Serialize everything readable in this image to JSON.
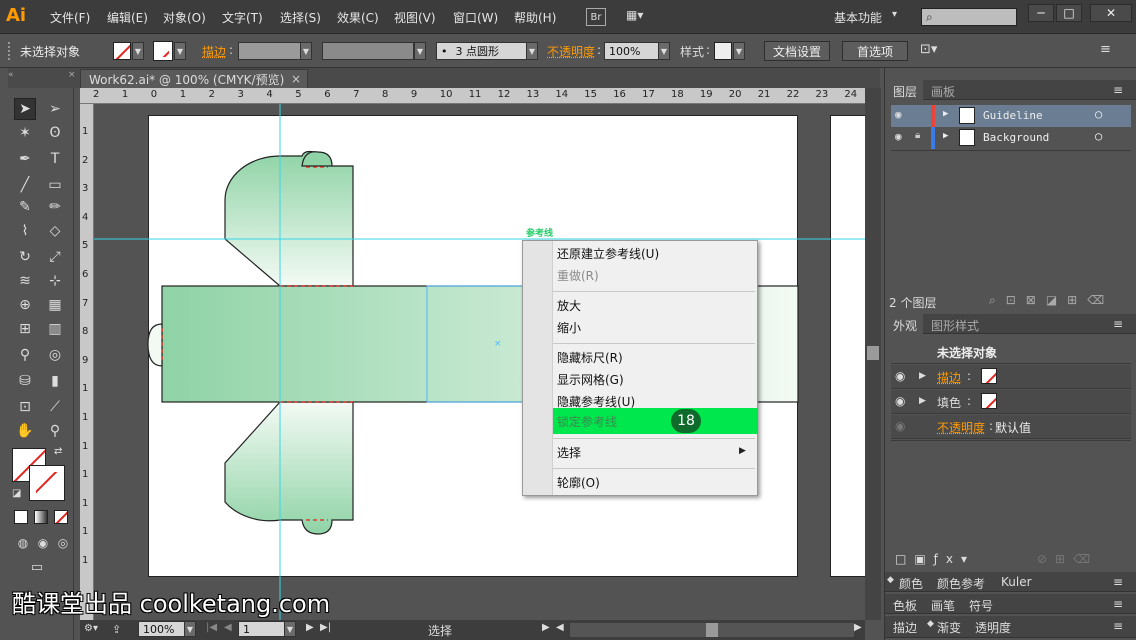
{
  "app": {
    "logo": "Ai",
    "window_buttons": [
      "─",
      "□",
      "✕"
    ]
  },
  "menu": {
    "items": [
      "文件(F)",
      "编辑(E)",
      "对象(O)",
      "文字(T)",
      "选择(S)",
      "效果(C)",
      "视图(V)",
      "窗口(W)",
      "帮助(H)"
    ],
    "bridge": "Br",
    "workspace": "基本功能",
    "search_placeholder": ""
  },
  "control": {
    "selection": "未选择对象",
    "stroke_label": "描边",
    "brush": "3 点圆形",
    "opacity_label": "不透明度",
    "opacity_value": "100%",
    "style_label": "样式",
    "doc_settings": "文档设置",
    "preferences": "首选项"
  },
  "document": {
    "tab_title": "Work62.ai* @ 100% (CMYK/预览)",
    "close": "×"
  },
  "rulers": {
    "h": [
      "2",
      "1",
      "0",
      "1",
      "2",
      "3",
      "4",
      "5",
      "6",
      "7",
      "8",
      "9",
      "10",
      "11",
      "12",
      "13",
      "14",
      "15",
      "16",
      "17",
      "18",
      "19",
      "20",
      "21",
      "22",
      "23",
      "24"
    ],
    "v": [
      "1",
      "2",
      "3",
      "4",
      "5",
      "6",
      "7",
      "8",
      "9",
      "1",
      "1",
      "1",
      "1",
      "1",
      "1",
      "1"
    ]
  },
  "canvas": {
    "guide_label": "参考线"
  },
  "context_menu": {
    "undo": "还原建立参考线(U)",
    "redo": "重做(R)",
    "zoom_in": "放大",
    "zoom_out": "缩小",
    "hide_rulers": "隐藏标尺(R)",
    "show_grid": "显示网格(G)",
    "hide_guides": "隐藏参考线(U)",
    "lock_guides": "锁定参考线",
    "select": "选择",
    "outline": "轮廓(O)",
    "step_badge": "18"
  },
  "layers": {
    "tabs": [
      "图层",
      "画板"
    ],
    "rows": [
      {
        "name": "Guideline",
        "color": "#e8443a"
      },
      {
        "name": "Background",
        "color": "#3a7be8"
      }
    ],
    "count": "2 个图层"
  },
  "appearance": {
    "tabs": [
      "外观",
      "图形样式"
    ],
    "title": "未选择对象",
    "stroke_label": "描边",
    "fill_label": "填色",
    "opacity_label": "不透明度",
    "opacity_value": "默认值"
  },
  "bottom_panels": {
    "row1": [
      "颜色",
      "颜色参考",
      "Kuler"
    ],
    "row2": [
      "色板",
      "画笔",
      "符号"
    ],
    "row3": [
      "描边",
      "渐变",
      "透明度"
    ]
  },
  "statusbar": {
    "zoom": "100%",
    "page": "1",
    "tool": "选择"
  },
  "watermark": "酷课堂出品 coolketang.com",
  "colors": {
    "accent_orange": "#ff9a00",
    "guide_cyan": "#36d6e6",
    "lock_green": "#00e64d",
    "shape_green": "#9fd9b0"
  }
}
